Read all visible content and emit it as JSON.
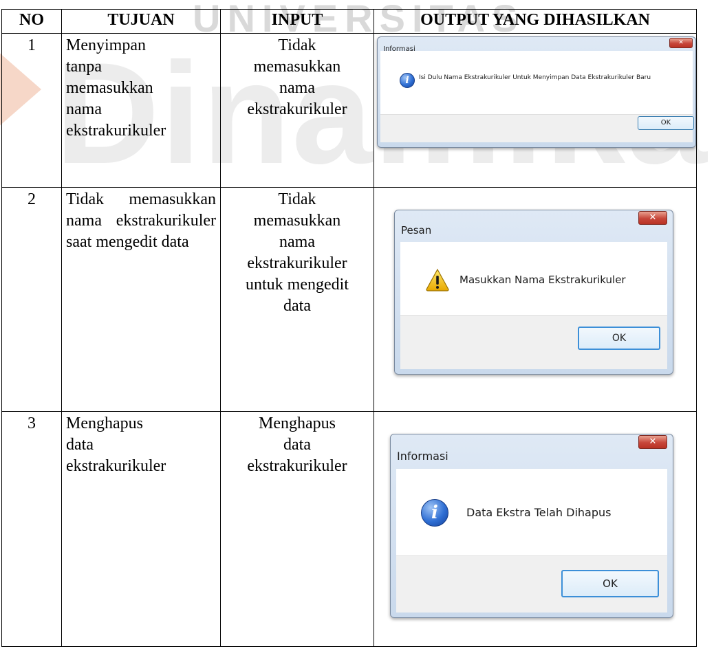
{
  "table": {
    "headers": {
      "no": "NO",
      "tujuan": "TUJUAN",
      "input": "INPUT",
      "output": "OUTPUT YANG DIHASILKAN"
    },
    "rows": [
      {
        "no": "1",
        "tujuan": "Menyimpan\ntanpa\nmemasukkan\nnama\nekstrakurikuler",
        "input": "Tidak\nmemasukkan\nnama\nekstrakurikuler",
        "dialog": {
          "title": "Informasi",
          "icon": "info-icon",
          "message": "Isi Dulu Nama Ekstrakurikuler Untuk Menyimpan Data Ekstrakurikuler Baru",
          "button": "OK"
        }
      },
      {
        "no": "2",
        "tujuan": "Tidak memasukkan nama ekstrakurikuler saat mengedit data",
        "input": "Tidak\nmemasukkan\nnama\nekstrakurikuler\nuntuk mengedit\ndata",
        "dialog": {
          "title": "Pesan",
          "icon": "warning-icon",
          "message": "Masukkan Nama Ekstrakurikuler",
          "button": "OK"
        }
      },
      {
        "no": "3",
        "tujuan": "Menghapus\ndata\nekstrakurikuler",
        "input": "Menghapus\ndata\nekstrakurikuler",
        "dialog": {
          "title": "Informasi",
          "icon": "info-icon",
          "message": "Data Ekstra Telah Dihapus",
          "button": "OK"
        }
      }
    ]
  },
  "watermark": {
    "top": "UNIVERSITAS",
    "main": "Dinamika"
  },
  "colors": {
    "watermark": "#ececec",
    "accent_logo": "#f6d7c8",
    "close_button": "#c7463a"
  }
}
